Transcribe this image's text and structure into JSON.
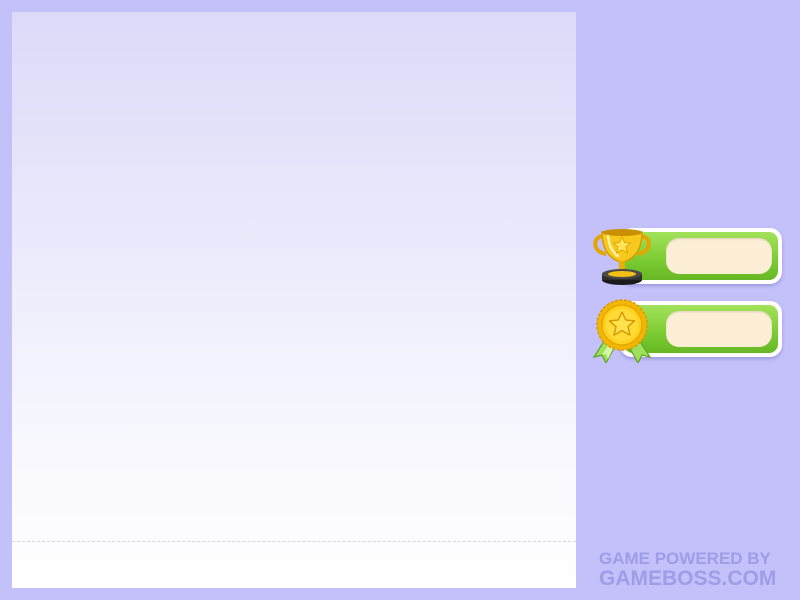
{
  "sidebar": {
    "trophy_stat": {
      "icon": "trophy-icon",
      "value": ""
    },
    "medal_stat": {
      "icon": "medal-icon",
      "value": ""
    }
  },
  "credit": {
    "line1": "GAME POWERED BY",
    "line2": "GAMEBOSS.COM"
  },
  "colors": {
    "background": "#c3c0fa",
    "pill_green": "#7ecd35",
    "value_field": "#fdeed6",
    "credit_text": "#9f9ce8"
  }
}
